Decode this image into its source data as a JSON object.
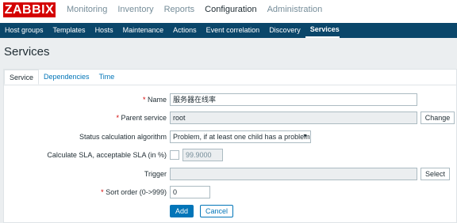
{
  "header": {
    "logo": "ZABBIX",
    "menu": [
      "Monitoring",
      "Inventory",
      "Reports",
      "Configuration",
      "Administration"
    ],
    "active_menu": "Configuration"
  },
  "subnav": {
    "items": [
      "Host groups",
      "Templates",
      "Hosts",
      "Maintenance",
      "Actions",
      "Event correlation",
      "Discovery",
      "Services"
    ],
    "active": "Services"
  },
  "page": {
    "title": "Services"
  },
  "tabs": [
    "Service",
    "Dependencies",
    "Time"
  ],
  "form": {
    "name_label": "Name",
    "name_value": "服务器在线率",
    "parent_label": "Parent service",
    "parent_value": "root",
    "change_button": "Change",
    "algorithm_label": "Status calculation algorithm",
    "algorithm_value": "Problem, if at least one child has a problem",
    "sla_label": "Calculate SLA, acceptable SLA (in %)",
    "sla_value": "99.9000",
    "trigger_label": "Trigger",
    "trigger_value": "",
    "select_button": "Select",
    "sort_label": "Sort order (0->999)",
    "sort_value": "0",
    "required_mark": "*",
    "add_button": "Add",
    "cancel_button": "Cancel"
  },
  "colors": {
    "brand": "#d40000",
    "nav": "#0a466a",
    "accent": "#0275b8"
  }
}
